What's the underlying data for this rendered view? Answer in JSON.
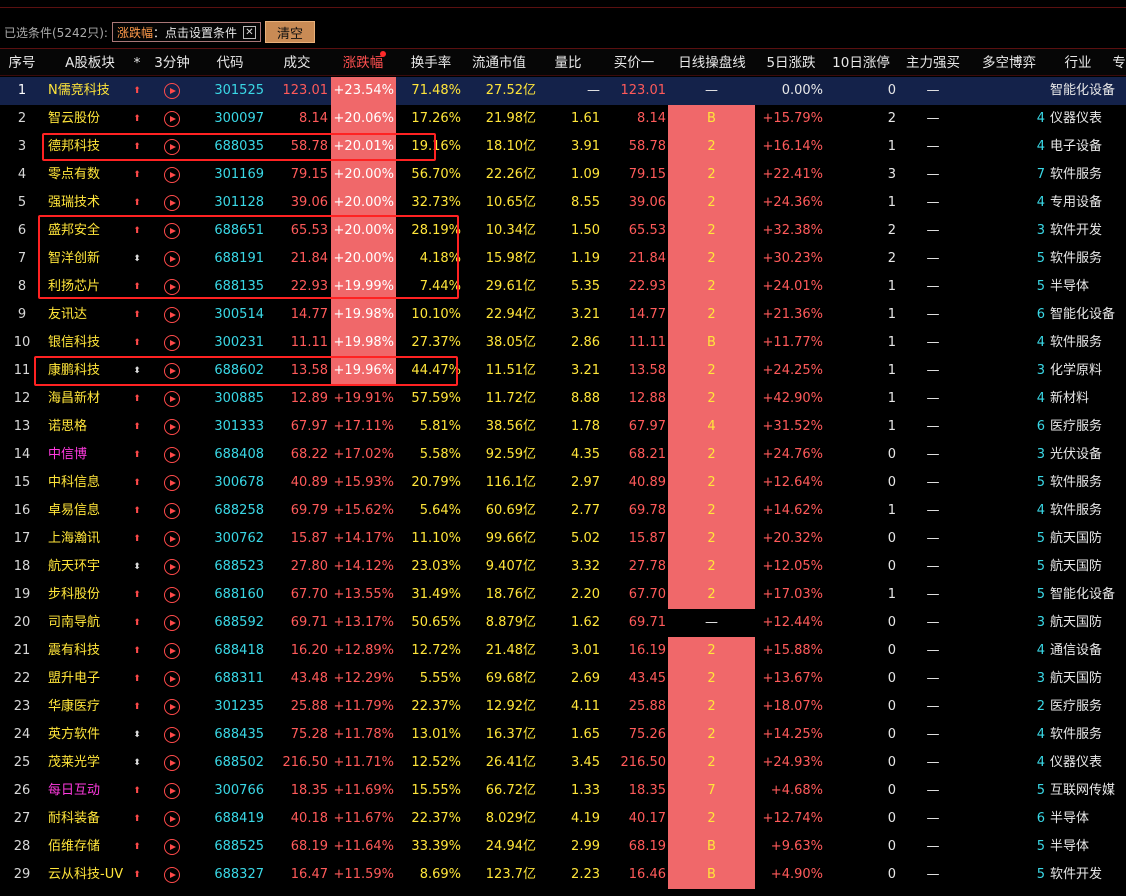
{
  "filter": {
    "label": "已选条件(5242只):",
    "tag_key": "涨跌幅",
    "tag_rest": "：点击设置条件",
    "close_glyph": "✕",
    "clear_label": "清空"
  },
  "columns": [
    "序号",
    "A股板块",
    "*",
    "3分钟",
    "代码",
    "成交",
    "涨跌幅",
    "换手率",
    "流通市值",
    "量比",
    "买价一",
    "日线操盘线",
    "5日涨跌",
    "10日涨停",
    "主力强买",
    "多空博弈",
    "行业",
    "专"
  ],
  "sorted_column": "涨跌幅",
  "colors": {
    "up": "#ff5a5a",
    "name": "#ffe53a",
    "code": "#3ad8e6",
    "highlight": "#f0686a",
    "box": "#ff2222",
    "selected_row": "#14224a"
  },
  "rows": [
    {
      "idx": "1",
      "name": "N儒竞科技",
      "star": "up",
      "code": "301525",
      "vol": "123.01",
      "chg": "+23.54%",
      "turn": "71.48%",
      "mcap": "27.52亿",
      "ratio": "—",
      "bid": "123.01",
      "day": "—",
      "d5": "0.00%",
      "d10": "0",
      "main": "—",
      "ms": "",
      "ind": "智能化设备",
      "selected": true,
      "hl": true,
      "dayhl": false
    },
    {
      "idx": "2",
      "name": "智云股份",
      "star": "up",
      "code": "300097",
      "vol": "8.14",
      "chg": "+20.06%",
      "turn": "17.26%",
      "mcap": "21.98亿",
      "ratio": "1.61",
      "bid": "8.14",
      "day": "B",
      "d5": "+15.79%",
      "d10": "2",
      "main": "—",
      "ms": "4",
      "ind": "仪器仪表",
      "hl": true,
      "dayhl": true
    },
    {
      "idx": "3",
      "name": "德邦科技",
      "star": "up",
      "code": "688035",
      "vol": "58.78",
      "chg": "+20.01%",
      "turn": "19.16%",
      "mcap": "18.10亿",
      "ratio": "3.91",
      "bid": "58.78",
      "day": "2",
      "d5": "+16.14%",
      "d10": "1",
      "main": "—",
      "ms": "4",
      "ind": "电子设备",
      "hl": true,
      "dayhl": true
    },
    {
      "idx": "4",
      "name": "零点有数",
      "star": "up",
      "code": "301169",
      "vol": "79.15",
      "chg": "+20.00%",
      "turn": "56.70%",
      "mcap": "22.26亿",
      "ratio": "1.09",
      "bid": "79.15",
      "day": "2",
      "d5": "+22.41%",
      "d10": "3",
      "main": "—",
      "ms": "7",
      "ind": "软件服务",
      "hl": true,
      "dayhl": true
    },
    {
      "idx": "5",
      "name": "强瑞技术",
      "star": "up",
      "code": "301128",
      "vol": "39.06",
      "chg": "+20.00%",
      "turn": "32.73%",
      "mcap": "10.65亿",
      "ratio": "8.55",
      "bid": "39.06",
      "day": "2",
      "d5": "+24.36%",
      "d10": "1",
      "main": "—",
      "ms": "4",
      "ind": "专用设备",
      "hl": true,
      "dayhl": true
    },
    {
      "idx": "6",
      "name": "盛邦安全",
      "star": "up",
      "code": "688651",
      "vol": "65.53",
      "chg": "+20.00%",
      "turn": "28.19%",
      "mcap": "10.34亿",
      "ratio": "1.50",
      "bid": "65.53",
      "day": "2",
      "d5": "+32.38%",
      "d10": "2",
      "main": "—",
      "ms": "3",
      "ind": "软件开发",
      "hl": true,
      "dayhl": true
    },
    {
      "idx": "7",
      "name": "智洋创新",
      "star": "ud",
      "code": "688191",
      "vol": "21.84",
      "chg": "+20.00%",
      "turn": "4.18%",
      "mcap": "15.98亿",
      "ratio": "1.19",
      "bid": "21.84",
      "day": "2",
      "d5": "+30.23%",
      "d10": "2",
      "main": "—",
      "ms": "5",
      "ind": "软件服务",
      "hl": true,
      "dayhl": true
    },
    {
      "idx": "8",
      "name": "利扬芯片",
      "star": "up",
      "code": "688135",
      "vol": "22.93",
      "chg": "+19.99%",
      "turn": "7.44%",
      "mcap": "29.61亿",
      "ratio": "5.35",
      "bid": "22.93",
      "day": "2",
      "d5": "+24.01%",
      "d10": "1",
      "main": "—",
      "ms": "5",
      "ind": "半导体",
      "hl": true,
      "dayhl": true
    },
    {
      "idx": "9",
      "name": "友讯达",
      "star": "up",
      "code": "300514",
      "vol": "14.77",
      "chg": "+19.98%",
      "turn": "10.10%",
      "mcap": "22.94亿",
      "ratio": "3.21",
      "bid": "14.77",
      "day": "2",
      "d5": "+21.36%",
      "d10": "1",
      "main": "—",
      "ms": "6",
      "ind": "智能化设备",
      "hl": true,
      "dayhl": true
    },
    {
      "idx": "10",
      "name": "银信科技",
      "star": "up",
      "code": "300231",
      "vol": "11.11",
      "chg": "+19.98%",
      "turn": "27.37%",
      "mcap": "38.05亿",
      "ratio": "2.86",
      "bid": "11.11",
      "day": "B",
      "d5": "+11.77%",
      "d10": "1",
      "main": "—",
      "ms": "4",
      "ind": "软件服务",
      "hl": true,
      "dayhl": true
    },
    {
      "idx": "11",
      "name": "康鹏科技",
      "star": "ud",
      "code": "688602",
      "vol": "13.58",
      "chg": "+19.96%",
      "turn": "44.47%",
      "mcap": "11.51亿",
      "ratio": "3.21",
      "bid": "13.58",
      "day": "2",
      "d5": "+24.25%",
      "d10": "1",
      "main": "—",
      "ms": "3",
      "ind": "化学原料",
      "hl": true,
      "dayhl": true
    },
    {
      "idx": "12",
      "name": "海昌新材",
      "star": "up",
      "code": "300885",
      "vol": "12.89",
      "chg": "+19.91%",
      "turn": "57.59%",
      "mcap": "11.72亿",
      "ratio": "8.88",
      "bid": "12.88",
      "day": "2",
      "d5": "+42.90%",
      "d10": "1",
      "main": "—",
      "ms": "4",
      "ind": "新材料",
      "hl": false,
      "dayhl": true
    },
    {
      "idx": "13",
      "name": "诺思格",
      "star": "up",
      "code": "301333",
      "vol": "67.97",
      "chg": "+17.11%",
      "turn": "5.81%",
      "mcap": "38.56亿",
      "ratio": "1.78",
      "bid": "67.97",
      "day": "4",
      "d5": "+31.52%",
      "d10": "1",
      "main": "—",
      "ms": "6",
      "ind": "医疗服务",
      "hl": false,
      "dayhl": true
    },
    {
      "idx": "14",
      "name": "中信博",
      "star": "up",
      "namecolor": "#ff3adf",
      "code": "688408",
      "vol": "68.22",
      "chg": "+17.02%",
      "turn": "5.58%",
      "mcap": "92.59亿",
      "ratio": "4.35",
      "bid": "68.21",
      "day": "2",
      "d5": "+24.76%",
      "d10": "0",
      "main": "—",
      "ms": "3",
      "ind": "光伏设备",
      "hl": false,
      "dayhl": true
    },
    {
      "idx": "15",
      "name": "中科信息",
      "star": "up",
      "code": "300678",
      "vol": "40.89",
      "chg": "+15.93%",
      "turn": "20.79%",
      "mcap": "116.1亿",
      "ratio": "2.97",
      "bid": "40.89",
      "day": "2",
      "d5": "+12.64%",
      "d10": "0",
      "main": "—",
      "ms": "5",
      "ind": "软件服务",
      "hl": false,
      "dayhl": true
    },
    {
      "idx": "16",
      "name": "卓易信息",
      "star": "up",
      "code": "688258",
      "vol": "69.79",
      "chg": "+15.62%",
      "turn": "5.64%",
      "mcap": "60.69亿",
      "ratio": "2.77",
      "bid": "69.78",
      "day": "2",
      "d5": "+14.62%",
      "d10": "1",
      "main": "—",
      "ms": "4",
      "ind": "软件服务",
      "hl": false,
      "dayhl": true
    },
    {
      "idx": "17",
      "name": "上海瀚讯",
      "star": "up",
      "code": "300762",
      "vol": "15.87",
      "chg": "+14.17%",
      "turn": "11.10%",
      "mcap": "99.66亿",
      "ratio": "5.02",
      "bid": "15.87",
      "day": "2",
      "d5": "+20.32%",
      "d10": "0",
      "main": "—",
      "ms": "5",
      "ind": "航天国防",
      "hl": false,
      "dayhl": true
    },
    {
      "idx": "18",
      "name": "航天环宇",
      "star": "ud",
      "code": "688523",
      "vol": "27.80",
      "chg": "+14.12%",
      "turn": "23.03%",
      "mcap": "9.407亿",
      "ratio": "3.32",
      "bid": "27.78",
      "day": "2",
      "d5": "+12.05%",
      "d10": "0",
      "main": "—",
      "ms": "5",
      "ind": "航天国防",
      "hl": false,
      "dayhl": true
    },
    {
      "idx": "19",
      "name": "步科股份",
      "star": "up",
      "code": "688160",
      "vol": "67.70",
      "chg": "+13.55%",
      "turn": "31.49%",
      "mcap": "18.76亿",
      "ratio": "2.20",
      "bid": "67.70",
      "day": "2",
      "d5": "+17.03%",
      "d10": "1",
      "main": "—",
      "ms": "5",
      "ind": "智能化设备",
      "hl": false,
      "dayhl": true
    },
    {
      "idx": "20",
      "name": "司南导航",
      "star": "up",
      "code": "688592",
      "vol": "69.71",
      "chg": "+13.17%",
      "turn": "50.65%",
      "mcap": "8.879亿",
      "ratio": "1.62",
      "bid": "69.71",
      "day": "—",
      "d5": "+12.44%",
      "d10": "0",
      "main": "—",
      "ms": "3",
      "ind": "航天国防",
      "hl": false,
      "dayhl": false
    },
    {
      "idx": "21",
      "name": "震有科技",
      "star": "up",
      "code": "688418",
      "vol": "16.20",
      "chg": "+12.89%",
      "turn": "12.72%",
      "mcap": "21.48亿",
      "ratio": "3.01",
      "bid": "16.19",
      "day": "2",
      "d5": "+15.88%",
      "d10": "0",
      "main": "—",
      "ms": "4",
      "ind": "通信设备",
      "hl": false,
      "dayhl": true
    },
    {
      "idx": "22",
      "name": "盟升电子",
      "star": "up",
      "code": "688311",
      "vol": "43.48",
      "chg": "+12.29%",
      "turn": "5.55%",
      "mcap": "69.68亿",
      "ratio": "2.69",
      "bid": "43.45",
      "day": "2",
      "d5": "+13.67%",
      "d10": "0",
      "main": "—",
      "ms": "3",
      "ind": "航天国防",
      "hl": false,
      "dayhl": true
    },
    {
      "idx": "23",
      "name": "华康医疗",
      "star": "up",
      "code": "301235",
      "vol": "25.88",
      "chg": "+11.79%",
      "turn": "22.37%",
      "mcap": "12.92亿",
      "ratio": "4.11",
      "bid": "25.88",
      "day": "2",
      "d5": "+18.07%",
      "d10": "0",
      "main": "—",
      "ms": "2",
      "ind": "医疗服务",
      "hl": false,
      "dayhl": true
    },
    {
      "idx": "24",
      "name": "英方软件",
      "star": "ud",
      "code": "688435",
      "vol": "75.28",
      "chg": "+11.78%",
      "turn": "13.01%",
      "mcap": "16.37亿",
      "ratio": "1.65",
      "bid": "75.26",
      "day": "2",
      "d5": "+14.25%",
      "d10": "0",
      "main": "—",
      "ms": "4",
      "ind": "软件服务",
      "hl": false,
      "dayhl": true
    },
    {
      "idx": "25",
      "name": "茂莱光学",
      "star": "ud",
      "code": "688502",
      "vol": "216.50",
      "chg": "+11.71%",
      "turn": "12.52%",
      "mcap": "26.41亿",
      "ratio": "3.45",
      "bid": "216.50",
      "day": "2",
      "d5": "+24.93%",
      "d10": "0",
      "main": "—",
      "ms": "4",
      "ind": "仪器仪表",
      "hl": false,
      "dayhl": true
    },
    {
      "idx": "26",
      "name": "每日互动",
      "star": "up",
      "namecolor": "#ff3adf",
      "code": "300766",
      "vol": "18.35",
      "chg": "+11.69%",
      "turn": "15.55%",
      "mcap": "66.72亿",
      "ratio": "1.33",
      "bid": "18.35",
      "day": "7",
      "d5": "+4.68%",
      "d10": "0",
      "main": "—",
      "ms": "5",
      "ind": "互联网传媒",
      "hl": false,
      "dayhl": true
    },
    {
      "idx": "27",
      "name": "耐科装备",
      "star": "up",
      "code": "688419",
      "vol": "40.18",
      "chg": "+11.67%",
      "turn": "22.37%",
      "mcap": "8.029亿",
      "ratio": "4.19",
      "bid": "40.17",
      "day": "2",
      "d5": "+12.74%",
      "d10": "0",
      "main": "—",
      "ms": "6",
      "ind": "半导体",
      "hl": false,
      "dayhl": true
    },
    {
      "idx": "28",
      "name": "佰维存储",
      "star": "up",
      "code": "688525",
      "vol": "68.19",
      "chg": "+11.64%",
      "turn": "33.39%",
      "mcap": "24.94亿",
      "ratio": "2.99",
      "bid": "68.19",
      "day": "B",
      "d5": "+9.63%",
      "d10": "0",
      "main": "—",
      "ms": "5",
      "ind": "半导体",
      "hl": false,
      "dayhl": true
    },
    {
      "idx": "29",
      "name": "云从科技-UV",
      "star": "up",
      "code": "688327",
      "vol": "16.47",
      "chg": "+11.59%",
      "turn": "8.69%",
      "mcap": "123.7亿",
      "ratio": "2.23",
      "bid": "16.46",
      "day": "B",
      "d5": "+4.90%",
      "d10": "0",
      "main": "—",
      "ms": "5",
      "ind": "软件开发",
      "hl": false,
      "dayhl": true
    }
  ]
}
